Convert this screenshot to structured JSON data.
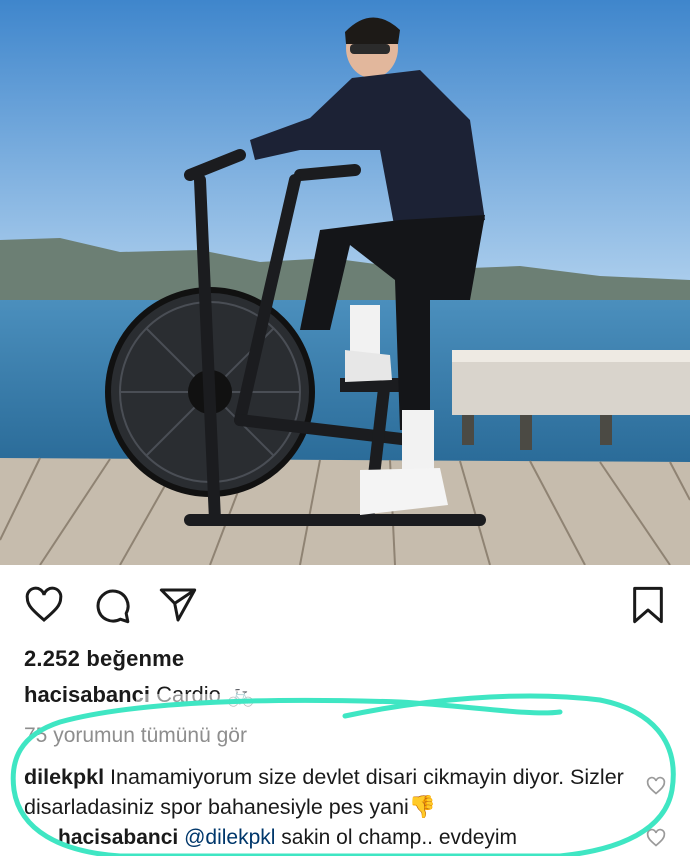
{
  "post": {
    "likes_text": "2.252 beğenme",
    "caption": {
      "username": "hacisabanci",
      "text": "Cardio 🚲"
    },
    "view_all_comments": "75 yorumun tümünü gör"
  },
  "comments": [
    {
      "username": "dilekpkl",
      "text": "Inamamiyorum size devlet disari cikmayin diyor. Sizler disarladasiniz spor bahanesiyle pes yani",
      "emoji": "👎"
    }
  ],
  "reply": {
    "username": "hacisabanci",
    "mention": "@dilekpkl",
    "text": "sakin ol champ.. evdeyim"
  },
  "icons": {
    "like": "heart-icon",
    "comment": "comment-icon",
    "share": "share-icon",
    "save": "bookmark-icon"
  },
  "colors": {
    "highlight": "#3fe6c3",
    "sky": "#5b9fd9",
    "water": "#2f7fb1",
    "deck": "#c9c1b3"
  }
}
